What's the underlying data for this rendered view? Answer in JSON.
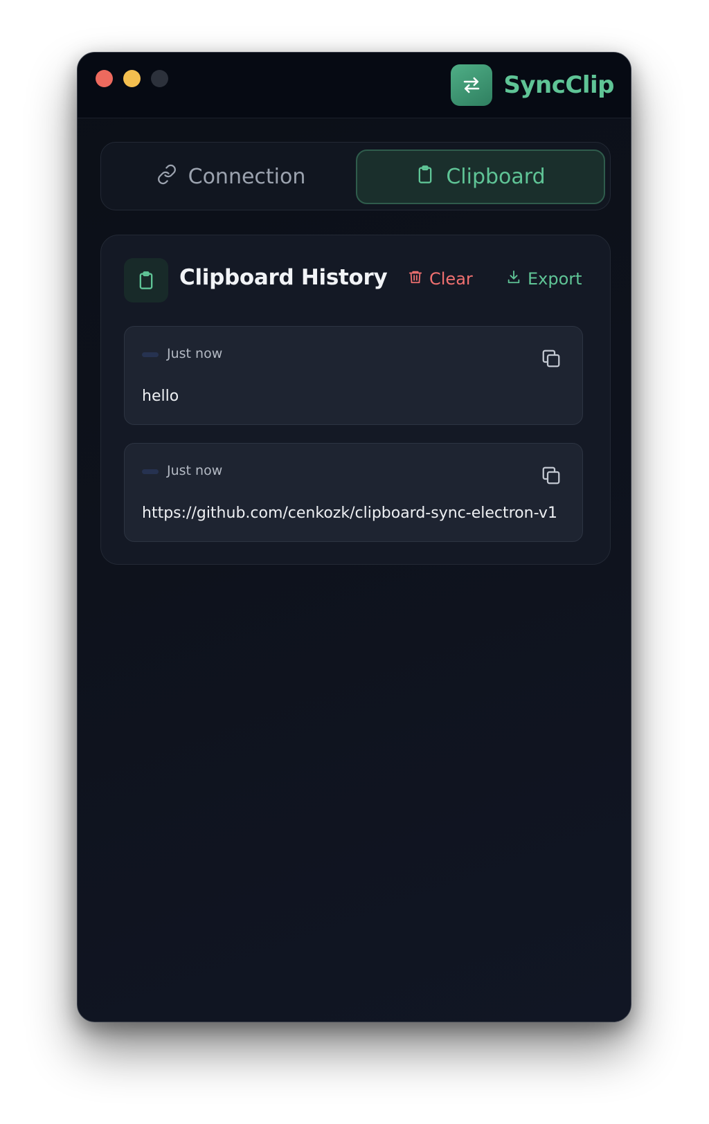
{
  "app": {
    "name": "SyncClip",
    "brand_color": "#5fc496",
    "logo_icon": "swap-arrows-icon"
  },
  "window_controls": [
    "close",
    "minimize",
    "zoom"
  ],
  "tabs": [
    {
      "label": "Connection",
      "icon": "link-icon",
      "active": false
    },
    {
      "label": "Clipboard",
      "icon": "clipboard-icon",
      "active": true
    }
  ],
  "history": {
    "title": "Clipboard History",
    "icon": "clipboard-icon",
    "clear_label": "Clear",
    "clear_color": "#f07070",
    "export_label": "Export",
    "items": [
      {
        "time": "Just now",
        "text": "hello"
      },
      {
        "time": "Just now",
        "text": "https://github.com/cenkozk/clipboard-sync-electron-v1"
      }
    ]
  }
}
